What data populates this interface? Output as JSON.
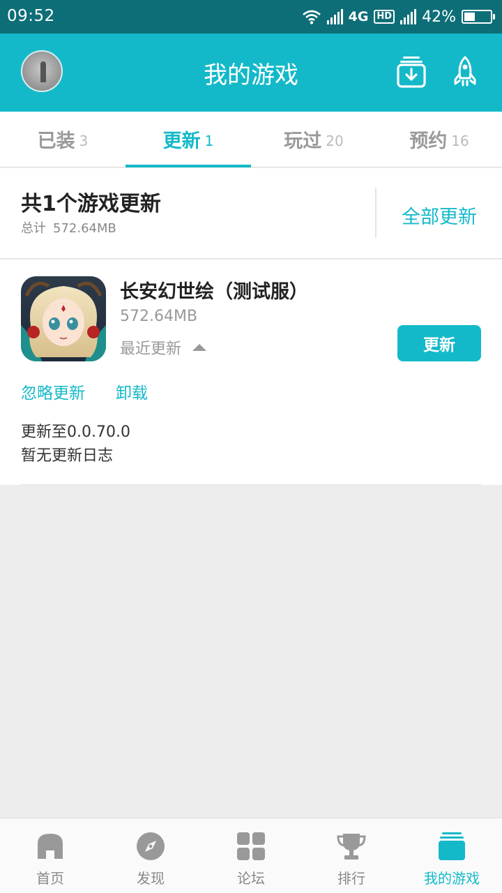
{
  "status_bar": {
    "time": "09:52",
    "network": "4G",
    "hd": "HD",
    "battery": "42%",
    "battery_level": 0.42
  },
  "header": {
    "title": "我的游戏",
    "icons": [
      "avatar",
      "download-manager-icon",
      "rocket-icon"
    ]
  },
  "tabs": [
    {
      "label": "已装",
      "count": "3"
    },
    {
      "label": "更新",
      "count": "1",
      "active": true
    },
    {
      "label": "玩过",
      "count": "20"
    },
    {
      "label": "预约",
      "count": "16"
    }
  ],
  "summary": {
    "title": "共1个游戏更新",
    "total_label": "总计",
    "total_size": "572.64MB",
    "update_all": "全部更新"
  },
  "game": {
    "name": "长安幻世绘（测试服）",
    "size": "572.64MB",
    "recent_label": "最近更新",
    "update_button": "更新",
    "ignore": "忽略更新",
    "uninstall": "卸载",
    "update_to": "更新至0.0.70.0",
    "changelog": "暂无更新日志"
  },
  "bottom_nav": [
    {
      "label": "首页",
      "icon": "home-icon"
    },
    {
      "label": "发现",
      "icon": "compass-icon"
    },
    {
      "label": "论坛",
      "icon": "grid-icon"
    },
    {
      "label": "排行",
      "icon": "trophy-icon"
    },
    {
      "label": "我的游戏",
      "icon": "my-games-icon",
      "active": true
    }
  ],
  "colors": {
    "accent": "#14b9c9",
    "status_bar": "#0e6e78",
    "background": "#ededed"
  }
}
